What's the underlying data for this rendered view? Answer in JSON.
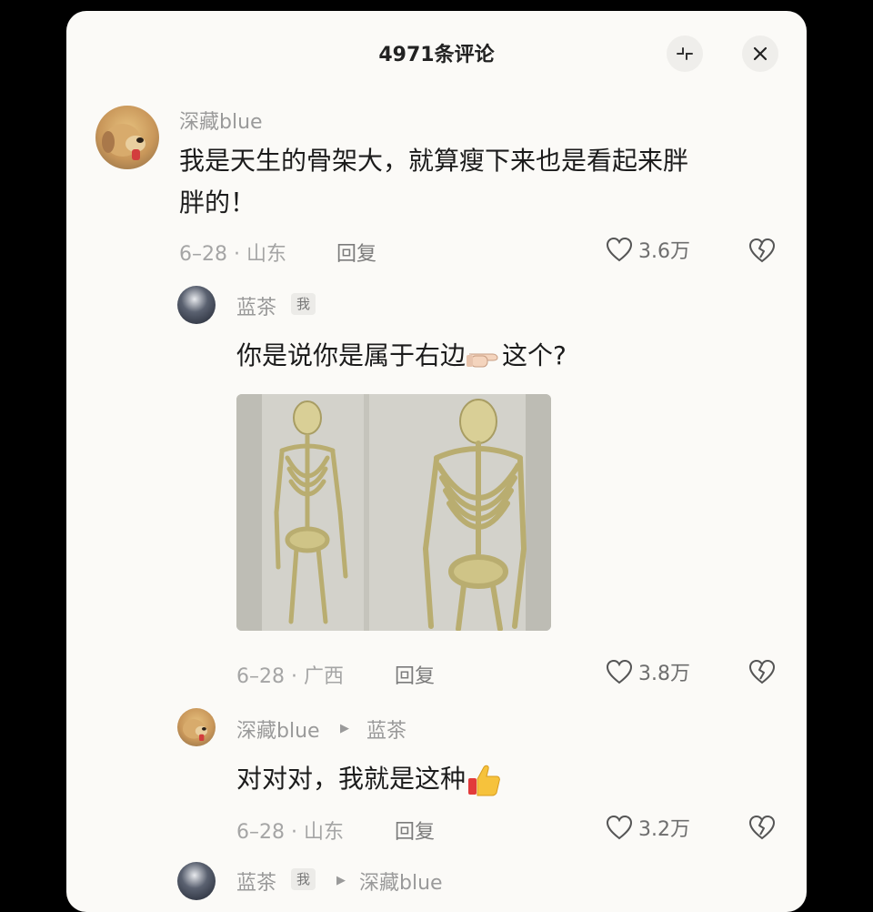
{
  "header": {
    "title": "4971条评论"
  },
  "icons": {
    "collapse": "collapse-icon",
    "close": "close-icon",
    "like": "heart-icon",
    "dislike": "broken-heart-icon",
    "pointing": "pointing-right-emoji",
    "thumbs_up": "thumbs-up-emoji"
  },
  "comments": [
    {
      "user": "深藏blue",
      "text": "我是天生的骨架大，就算瘦下来也是看起来胖胖的！",
      "text_line1": "我是天生的骨架大，就算瘦下来也是看起来胖",
      "text_line2": "胖的！",
      "meta": "6–28 · 山东",
      "reply": "回复",
      "likes": "3.6万"
    },
    {
      "user": "蓝茶",
      "tag": "我",
      "text_before": "你是说你是属于右边",
      "text_after": "这个?",
      "meta": "6–28 · 广西",
      "reply": "回复",
      "likes": "3.8万"
    },
    {
      "user": "深藏blue",
      "reply_to": "蓝茶",
      "text": "对对对，我就是这种",
      "meta": "6–28 · 山东",
      "reply": "回复",
      "likes": "3.2万"
    },
    {
      "user": "蓝茶",
      "tag": "我",
      "reply_to": "深藏blue"
    }
  ],
  "colors": {
    "sheet_bg": "#fbfaf7",
    "backdrop": "#000000",
    "text_primary": "#1c1c1c",
    "text_secondary": "#9a9a9a"
  }
}
